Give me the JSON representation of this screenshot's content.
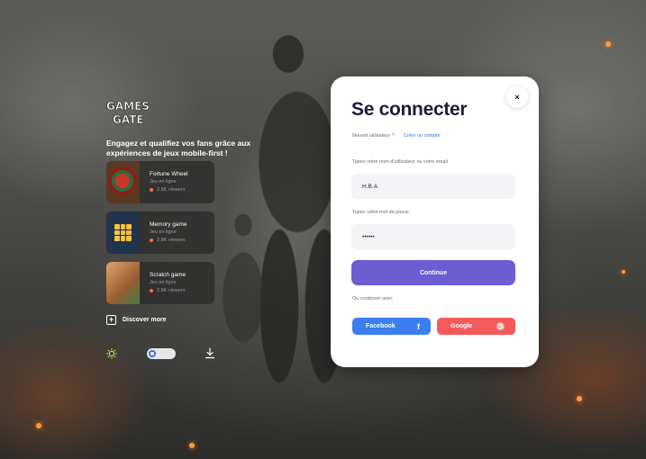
{
  "brand": {
    "logo_text_line1": "GAMES",
    "logo_text_line2": "GATE",
    "tagline": "Engagez et qualifiez vos fans grâce aux expériences de jeux mobile-first !"
  },
  "games": [
    {
      "title": "Fortune Wheel",
      "subtitle": "Jeu en ligne",
      "viewers": "2.8K viewers",
      "thumb": "wheel"
    },
    {
      "title": "Memory game",
      "subtitle": "Jeu en ligne",
      "viewers": "2.8K viewers",
      "thumb": "memory"
    },
    {
      "title": "Scratch game",
      "subtitle": "Jeu en ligne",
      "viewers": "2.8K viewers",
      "thumb": "scratch"
    }
  ],
  "discover_label": "Discover more",
  "footer_controls": {
    "theme_icon": "sun-icon",
    "toggle_state": "off",
    "download_icon": "download-icon"
  },
  "login": {
    "title": "Se connecter",
    "new_user_text": "Nouvel utilisateur ?",
    "create_account_link": "Créer un compte",
    "username_label": "Tapez votre nom d'utilisateur ou votre email",
    "username_value": "H.B.A",
    "password_label": "Tapez votre mot de passe",
    "password_value": "••••••",
    "continue_label": "Continue",
    "or_continue_text": "Ou continuer avec",
    "facebook_label": "Facebook",
    "google_label": "Google",
    "close_icon": "×"
  },
  "colors": {
    "primary_button": "#6c5dd3",
    "facebook": "#3b7ef0",
    "google": "#f45a5a",
    "link": "#3b6df0",
    "title": "#1a1c3a"
  }
}
